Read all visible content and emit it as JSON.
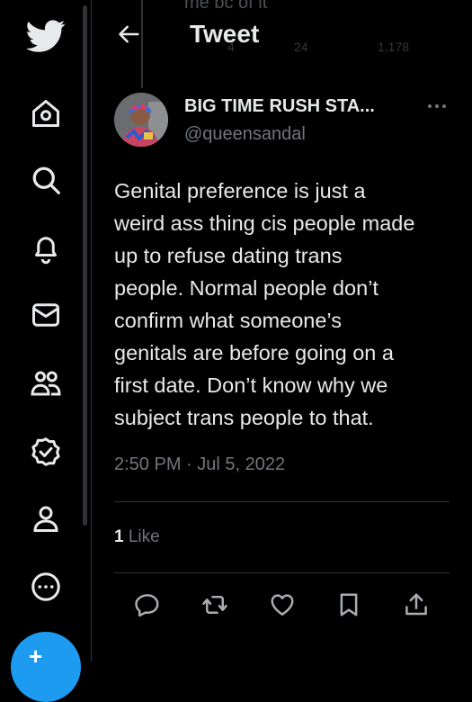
{
  "header": {
    "title": "Tweet"
  },
  "ghost": {
    "text": "me bc of it",
    "counts": [
      "4",
      "24",
      "1,178"
    ]
  },
  "tweet": {
    "author_name": "BIG TIME RUSH STA...",
    "author_handle": "@queensandal",
    "text_lines": [
      "Genital preference is just a",
      "weird ass thing cis people made",
      "up to refuse dating trans",
      "people. Normal people don’t",
      "confirm what someone’s",
      "genitals are before going on a",
      "first date. Don’t know why we",
      "subject trans people to that."
    ],
    "timestamp": "2:50 PM · Jul 5, 2022",
    "like_count": "1",
    "like_label": "Like"
  },
  "nav": {
    "icons": [
      "twitter-logo",
      "home-icon",
      "search-icon",
      "notifications-icon",
      "messages-icon",
      "communities-icon",
      "verified-icon",
      "profile-icon",
      "more-icon"
    ]
  },
  "colors": {
    "accent": "#1d9bf0",
    "background": "#000000",
    "text": "#e7e9ea",
    "muted": "#71767b",
    "border": "#2f3336"
  }
}
